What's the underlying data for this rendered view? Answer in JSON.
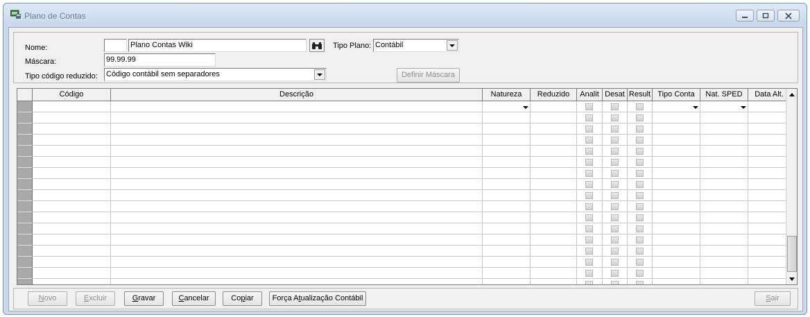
{
  "window": {
    "title": "Plano de Contas"
  },
  "form": {
    "nome_label": "Nome:",
    "nome_code": "",
    "nome_value": "Plano Contas Wiki",
    "tipo_plano_label": "Tipo Plano:",
    "tipo_plano_value": "Contábil",
    "mascara_label": "Máscara:",
    "mascara_value": "99.99.99",
    "tipo_codigo_label": "Tipo código reduzido:",
    "tipo_codigo_value": "Código contábil sem separadores",
    "definir_mascara_label": "Definir Máscara"
  },
  "grid": {
    "columns": [
      "Código",
      "Descrição",
      "Natureza",
      "Reduzido",
      "Analit",
      "Desat",
      "Result",
      "Tipo Conta",
      "Nat. SPED",
      "Data Alt."
    ],
    "row_count": 17
  },
  "buttons": {
    "novo": {
      "pre": "",
      "key": "N",
      "post": "ovo"
    },
    "excluir": {
      "pre": "",
      "key": "E",
      "post": "xcluir"
    },
    "gravar": {
      "pre": "",
      "key": "G",
      "post": "ravar"
    },
    "cancelar": {
      "pre": "",
      "key": "C",
      "post": "ancelar"
    },
    "copiar": {
      "pre": "Co",
      "key": "p",
      "post": "iar"
    },
    "forca": {
      "pre": "Força A",
      "key": "t",
      "post": "ualização Contábil"
    },
    "sair": {
      "pre": "",
      "key": "S",
      "post": "air"
    }
  }
}
